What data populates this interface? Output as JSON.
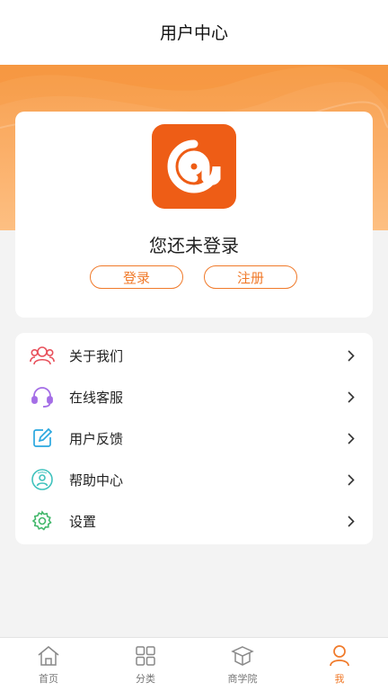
{
  "header": {
    "title": "用户中心"
  },
  "colors": {
    "accent": "#f07a2a",
    "logo_bg": "#ee5d16",
    "banner": "#f7a04f"
  },
  "profile": {
    "logo_icon": "at-sign-logo",
    "status_text": "您还未登录",
    "login_label": "登录",
    "register_label": "注册"
  },
  "menu": {
    "items": [
      {
        "label": "关于我们",
        "icon": "users-icon"
      },
      {
        "label": "在线客服",
        "icon": "headset-icon"
      },
      {
        "label": "用户反馈",
        "icon": "edit-icon"
      },
      {
        "label": "帮助中心",
        "icon": "help-icon"
      },
      {
        "label": "设置",
        "icon": "gear-icon"
      }
    ]
  },
  "tabs": {
    "items": [
      {
        "label": "首页",
        "icon": "home-icon"
      },
      {
        "label": "分类",
        "icon": "grid-icon"
      },
      {
        "label": "商学院",
        "icon": "graduation-cap-icon"
      },
      {
        "label": "我",
        "icon": "person-icon",
        "active": true
      }
    ]
  }
}
